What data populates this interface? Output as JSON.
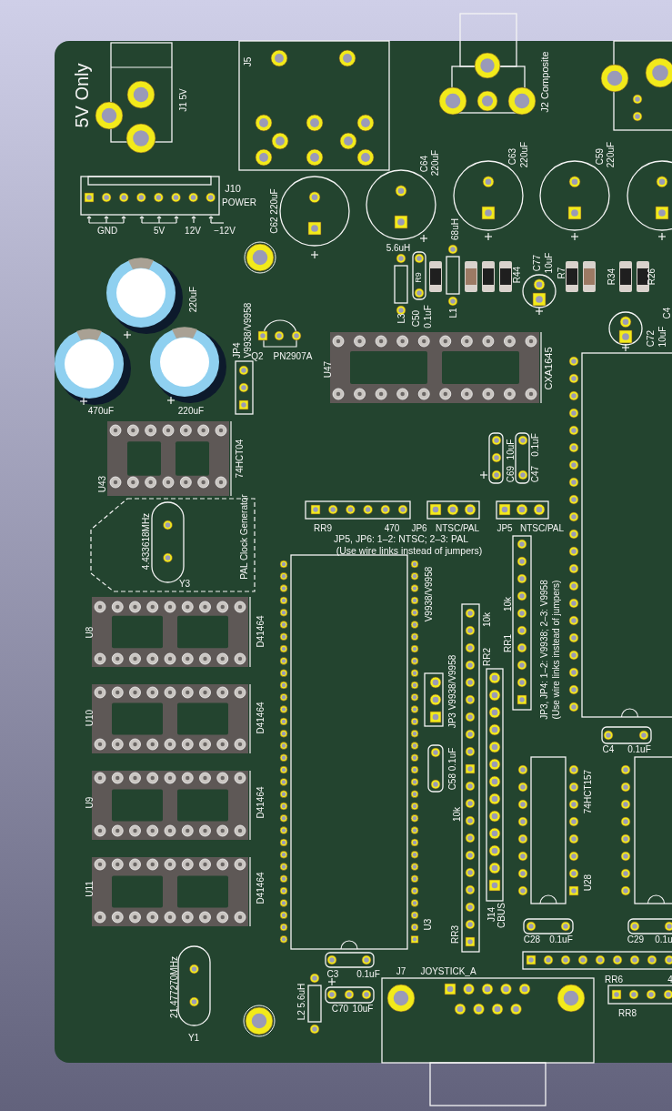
{
  "board": {
    "labels": [
      "5V Only",
      "J1 5V",
      "J5",
      "J2 Composite",
      "J10",
      "POWER",
      "GND",
      "5V",
      "12V",
      "−12V",
      "C62 220uF",
      "C64",
      "220uF",
      "C63",
      "220uF",
      "C59",
      "220uF",
      "5.6uH",
      "R9",
      "68uH",
      "R44",
      "C77",
      "10uF",
      "R7",
      "R34",
      "R26",
      "L3",
      "C50",
      "0.1uF",
      "L1",
      "C72",
      "10uF",
      "C4",
      "CXA1645",
      "JP4",
      "V9938/V9958",
      "Q2",
      "PN2907A",
      "U47",
      "220uF",
      "470uF",
      "220uF",
      "74HCT04",
      "U43",
      "PAL Clock Generator",
      "4.433618MHz",
      "Y3",
      "U8",
      "D41464",
      "U10",
      "D41464",
      "U9",
      "D41464",
      "U11",
      "D41464",
      "RR9",
      "470",
      "JP6",
      "NTSC/PAL",
      "JP5",
      "NTSC/PAL",
      "JP5, JP6: 1–2: NTSC;  2–3: PAL",
      "(Use wire links instead of jumpers)",
      "C69",
      "10uF",
      "C47",
      "0.1uF",
      "V9938/V9958",
      "10k",
      "RR1",
      "10k",
      "RR2",
      "JP3 V9938/V9958",
      "JP3, JP4: 1–2: V9938; 2–3: V9958",
      "(Use wire links instead of jumpers)",
      "C58 0.1uF",
      "C4",
      "0.1uF",
      "10k",
      "74HCT157",
      "U28",
      "U3",
      "RR3",
      "J14",
      "CBUS",
      "C28",
      "0.1uF",
      "C29",
      "0.1u",
      "C3",
      "0.1uF",
      "C70",
      "10uF",
      "J7",
      "JOYSTICK_A",
      "RR6",
      "4",
      "RR8",
      "L2 5.6uH",
      "21.477270MHz",
      "Y1"
    ]
  }
}
